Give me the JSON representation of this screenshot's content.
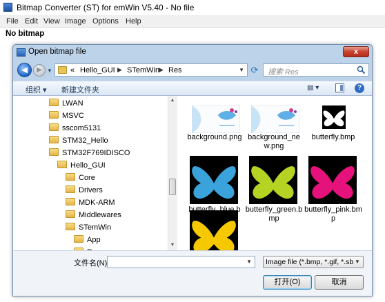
{
  "app": {
    "title": "Bitmap Converter (ST) for emWin V5.40 - No file",
    "menu": [
      "File",
      "Edit",
      "View",
      "Image",
      "Options",
      "Help"
    ],
    "status": "No bitmap"
  },
  "dialog": {
    "title": "Open bitmap file",
    "close_glyph": "x",
    "breadcrumb": [
      "«",
      "Hello_GUI",
      "STemWin",
      "Res"
    ],
    "search_placeholder": "搜索 Res",
    "toolbar": {
      "organize": "组织 ▾",
      "new_folder": "新建文件夹",
      "view_glyph": "▤ ▾",
      "help_glyph": "?"
    },
    "tree": [
      {
        "label": "LWAN",
        "indent": 0
      },
      {
        "label": "MSVC",
        "indent": 0
      },
      {
        "label": "sscom5131",
        "indent": 0
      },
      {
        "label": "STM32_Hello",
        "indent": 0
      },
      {
        "label": "STM32F769IDISCO",
        "indent": 0
      },
      {
        "label": "Hello_GUI",
        "indent": 1
      },
      {
        "label": "Core",
        "indent": 2
      },
      {
        "label": "Drivers",
        "indent": 2
      },
      {
        "label": "MDK-ARM",
        "indent": 2
      },
      {
        "label": "Middlewares",
        "indent": 2
      },
      {
        "label": "STemWin",
        "indent": 2
      },
      {
        "label": "App",
        "indent": 3
      },
      {
        "label": "Res",
        "indent": 3
      }
    ],
    "files": [
      {
        "label": "background.png",
        "thumb": "bg"
      },
      {
        "label": "background_new.png",
        "thumb": "bg"
      },
      {
        "label": "butterfly.bmp",
        "thumb": "butterfly",
        "color": "#ffffff",
        "bg": "#000000"
      },
      {
        "label": "butterfly_blue.bmp",
        "thumb": "butterfly",
        "color": "#3ba3dc",
        "bg": "#000000"
      },
      {
        "label": "butterfly_green.bmp",
        "thumb": "butterfly",
        "color": "#b5d323",
        "bg": "#000000"
      },
      {
        "label": "butterfly_pink.bmp",
        "thumb": "butterfly",
        "color": "#e5127c",
        "bg": "#000000"
      },
      {
        "label": "",
        "thumb": "butterfly",
        "color": "#f5c800",
        "bg": "#000000"
      }
    ],
    "filename_label": "文件名(N):",
    "filename_value": "",
    "filter_value": "Image file (*.bmp, *.gif, *.sbr",
    "open_label": "打开(O)",
    "cancel_label": "取消"
  }
}
